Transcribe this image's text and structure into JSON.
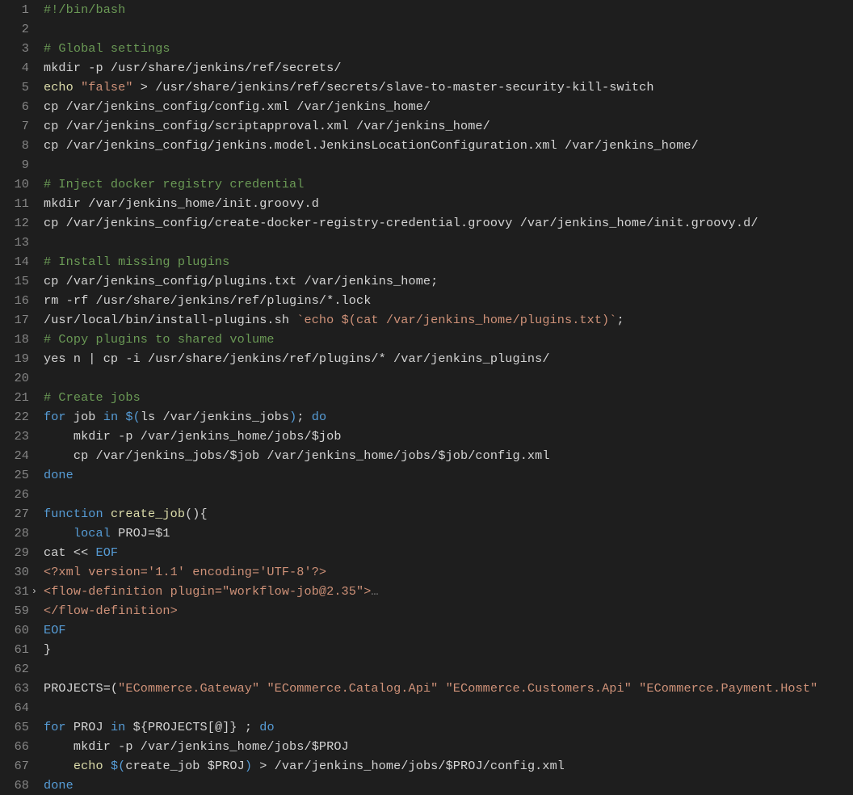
{
  "language": "bash",
  "fold_marker_line": 31,
  "lines": [
    {
      "num": 1,
      "tokens": [
        {
          "t": "#!/bin/bash",
          "c": "comment"
        }
      ]
    },
    {
      "num": 2,
      "tokens": []
    },
    {
      "num": 3,
      "tokens": [
        {
          "t": "# Global settings",
          "c": "comment"
        }
      ]
    },
    {
      "num": 4,
      "tokens": [
        {
          "t": "mkdir -p /usr/share/jenkins/ref/secrets/",
          "c": "default"
        }
      ]
    },
    {
      "num": 5,
      "tokens": [
        {
          "t": "echo",
          "c": "func"
        },
        {
          "t": " ",
          "c": "default"
        },
        {
          "t": "\"false\"",
          "c": "string"
        },
        {
          "t": " > /usr/share/jenkins/ref/secrets/slave-to-master-security-kill-switch",
          "c": "default"
        }
      ]
    },
    {
      "num": 6,
      "tokens": [
        {
          "t": "cp /var/jenkins_config/config.xml /var/jenkins_home/",
          "c": "default"
        }
      ]
    },
    {
      "num": 7,
      "tokens": [
        {
          "t": "cp /var/jenkins_config/scriptapproval.xml /var/jenkins_home/",
          "c": "default"
        }
      ]
    },
    {
      "num": 8,
      "tokens": [
        {
          "t": "cp /var/jenkins_config/jenkins.model.JenkinsLocationConfiguration.xml /var/jenkins_home/",
          "c": "default"
        }
      ]
    },
    {
      "num": 9,
      "tokens": []
    },
    {
      "num": 10,
      "tokens": [
        {
          "t": "# Inject docker registry credential",
          "c": "comment"
        }
      ]
    },
    {
      "num": 11,
      "tokens": [
        {
          "t": "mkdir /var/jenkins_home/init.groovy.d",
          "c": "default"
        }
      ]
    },
    {
      "num": 12,
      "tokens": [
        {
          "t": "cp /var/jenkins_config/create-docker-registry-credential.groovy /var/jenkins_home/init.groovy.d/",
          "c": "default"
        }
      ]
    },
    {
      "num": 13,
      "tokens": []
    },
    {
      "num": 14,
      "tokens": [
        {
          "t": "# Install missing plugins",
          "c": "comment"
        }
      ]
    },
    {
      "num": 15,
      "tokens": [
        {
          "t": "cp /var/jenkins_config/plugins.txt /var/jenkins_home;",
          "c": "default"
        }
      ]
    },
    {
      "num": 16,
      "tokens": [
        {
          "t": "rm -rf /usr/share/jenkins/ref/plugins/*.lock",
          "c": "default"
        }
      ]
    },
    {
      "num": 17,
      "tokens": [
        {
          "t": "/usr/local/bin/install-plugins.sh ",
          "c": "default"
        },
        {
          "t": "`echo $(cat /var/jenkins_home/plugins.txt)`",
          "c": "string"
        },
        {
          "t": ";",
          "c": "default"
        }
      ]
    },
    {
      "num": 18,
      "tokens": [
        {
          "t": "# Copy plugins to shared volume",
          "c": "comment"
        }
      ]
    },
    {
      "num": 19,
      "tokens": [
        {
          "t": "yes n | cp -i /usr/share/jenkins/ref/plugins/* /var/jenkins_plugins/",
          "c": "default"
        }
      ]
    },
    {
      "num": 20,
      "tokens": []
    },
    {
      "num": 21,
      "tokens": [
        {
          "t": "# Create jobs",
          "c": "comment"
        }
      ]
    },
    {
      "num": 22,
      "tokens": [
        {
          "t": "for",
          "c": "keyword"
        },
        {
          "t": " job ",
          "c": "default"
        },
        {
          "t": "in",
          "c": "keyword"
        },
        {
          "t": " ",
          "c": "default"
        },
        {
          "t": "$(",
          "c": "keyword"
        },
        {
          "t": "ls /var/jenkins_jobs",
          "c": "default"
        },
        {
          "t": ")",
          "c": "keyword"
        },
        {
          "t": "; ",
          "c": "default"
        },
        {
          "t": "do",
          "c": "keyword"
        }
      ]
    },
    {
      "num": 23,
      "indent": 1,
      "tokens": [
        {
          "t": "    mkdir -p /var/jenkins_home/jobs/$job",
          "c": "default"
        }
      ]
    },
    {
      "num": 24,
      "indent": 1,
      "tokens": [
        {
          "t": "    cp /var/jenkins_jobs/$job /var/jenkins_home/jobs/$job/config.xml",
          "c": "default"
        }
      ]
    },
    {
      "num": 25,
      "tokens": [
        {
          "t": "done",
          "c": "keyword"
        }
      ]
    },
    {
      "num": 26,
      "tokens": []
    },
    {
      "num": 27,
      "tokens": [
        {
          "t": "function",
          "c": "keyword"
        },
        {
          "t": " ",
          "c": "default"
        },
        {
          "t": "create_job",
          "c": "func"
        },
        {
          "t": "(){",
          "c": "default"
        }
      ]
    },
    {
      "num": 28,
      "indent": 1,
      "tokens": [
        {
          "t": "    ",
          "c": "default"
        },
        {
          "t": "local",
          "c": "keyword"
        },
        {
          "t": " PROJ=$1",
          "c": "default"
        }
      ]
    },
    {
      "num": 29,
      "tokens": [
        {
          "t": "cat << ",
          "c": "default"
        },
        {
          "t": "EOF",
          "c": "keyword"
        }
      ]
    },
    {
      "num": 30,
      "tokens": [
        {
          "t": "<?xml version='1.1' encoding='UTF-8'?>",
          "c": "string"
        }
      ]
    },
    {
      "num": 31,
      "tokens": [
        {
          "t": "<flow-definition plugin=\"workflow-job@2.35\">",
          "c": "string"
        },
        {
          "t": "…",
          "c": "dim"
        }
      ]
    },
    {
      "num": 59,
      "tokens": [
        {
          "t": "</flow-definition>",
          "c": "string"
        }
      ]
    },
    {
      "num": 60,
      "tokens": [
        {
          "t": "EOF",
          "c": "keyword"
        }
      ]
    },
    {
      "num": 61,
      "tokens": [
        {
          "t": "}",
          "c": "default"
        }
      ]
    },
    {
      "num": 62,
      "tokens": []
    },
    {
      "num": 63,
      "tokens": [
        {
          "t": "PROJECTS=(",
          "c": "default"
        },
        {
          "t": "\"ECommerce.Gateway\"",
          "c": "string"
        },
        {
          "t": " ",
          "c": "default"
        },
        {
          "t": "\"ECommerce.Catalog.Api\"",
          "c": "string"
        },
        {
          "t": " ",
          "c": "default"
        },
        {
          "t": "\"ECommerce.Customers.Api\"",
          "c": "string"
        },
        {
          "t": " ",
          "c": "default"
        },
        {
          "t": "\"ECommerce.Payment.Host\"",
          "c": "string"
        }
      ]
    },
    {
      "num": 64,
      "tokens": []
    },
    {
      "num": 65,
      "tokens": [
        {
          "t": "for",
          "c": "keyword"
        },
        {
          "t": " PROJ ",
          "c": "default"
        },
        {
          "t": "in",
          "c": "keyword"
        },
        {
          "t": " ${PROJECTS[@]} ; ",
          "c": "default"
        },
        {
          "t": "do",
          "c": "keyword"
        }
      ]
    },
    {
      "num": 66,
      "indent": 1,
      "tokens": [
        {
          "t": "    mkdir -p /var/jenkins_home/jobs/$PROJ",
          "c": "default"
        }
      ]
    },
    {
      "num": 67,
      "indent": 1,
      "tokens": [
        {
          "t": "    ",
          "c": "default"
        },
        {
          "t": "echo",
          "c": "func"
        },
        {
          "t": " ",
          "c": "default"
        },
        {
          "t": "$(",
          "c": "keyword"
        },
        {
          "t": "create_job $PROJ",
          "c": "default"
        },
        {
          "t": ")",
          "c": "keyword"
        },
        {
          "t": " > /var/jenkins_home/jobs/$PROJ/config.xml",
          "c": "default"
        }
      ]
    },
    {
      "num": 68,
      "tokens": [
        {
          "t": "done",
          "c": "keyword"
        }
      ]
    }
  ]
}
